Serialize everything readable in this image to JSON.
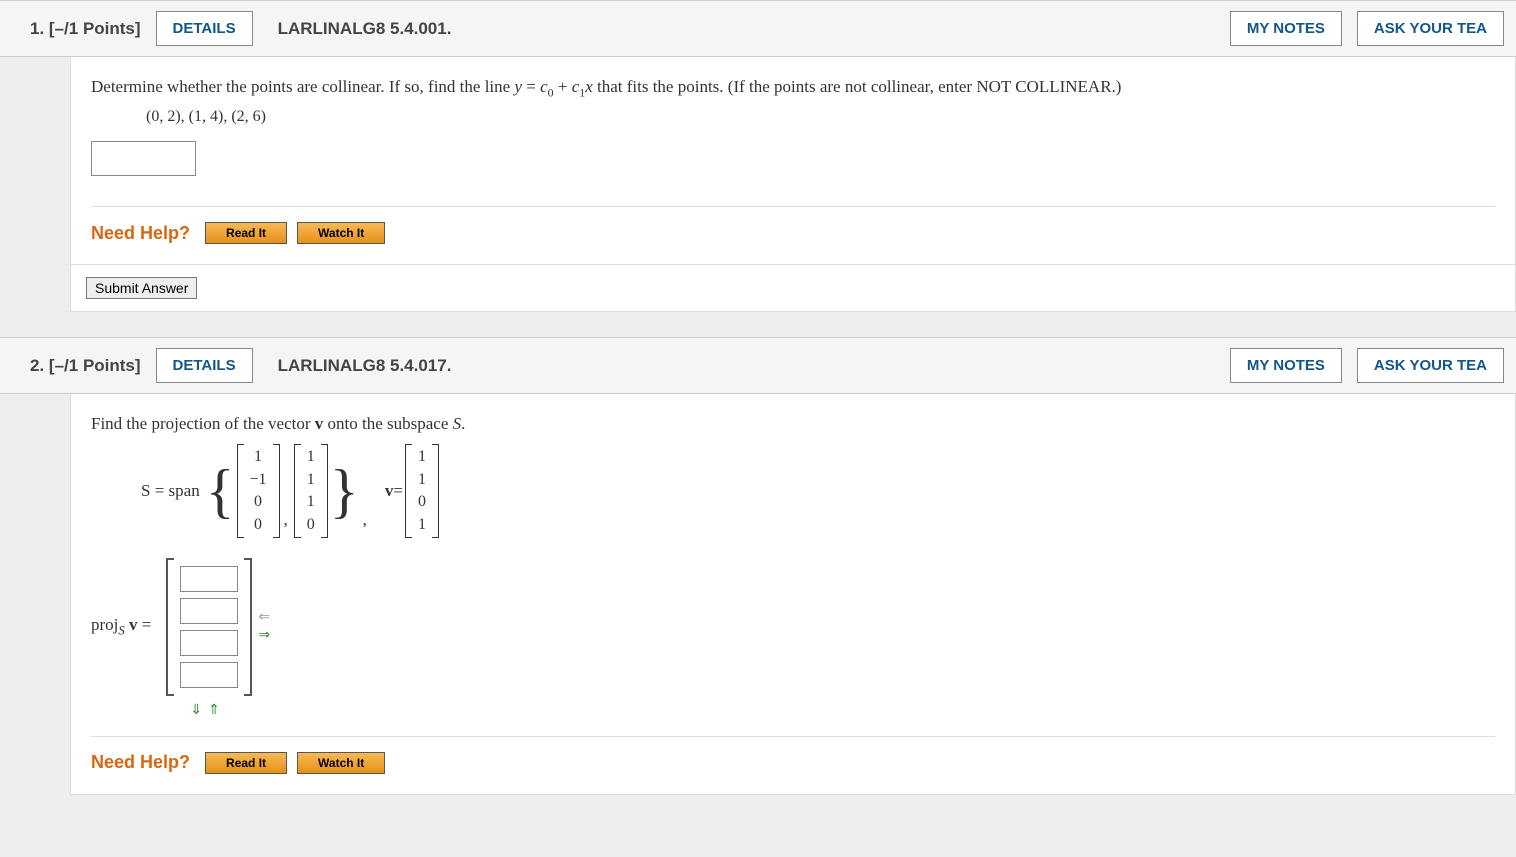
{
  "questions": [
    {
      "number": "1.",
      "points": "[–/1 Points]",
      "details_label": "DETAILS",
      "ref": "LARLINALG8 5.4.001.",
      "notes_label": "MY NOTES",
      "ask_label": "ASK YOUR TEA",
      "prompt_pre": "Determine whether the points are collinear. If so, find the line  ",
      "prompt_eq_y": "y",
      "prompt_eq_eq": " = ",
      "prompt_eq_c0": "c",
      "prompt_eq_c0sub": "0",
      "prompt_eq_plus": " + ",
      "prompt_eq_c1": "c",
      "prompt_eq_c1sub": "1",
      "prompt_eq_x": "x",
      "prompt_post": "  that fits the points. (If the points are not collinear, enter NOT COLLINEAR.)",
      "points_list": "(0, 2), (1, 4), (2, 6)",
      "need_help": "Need Help?",
      "read_it": "Read It",
      "watch_it": "Watch It",
      "submit": "Submit Answer"
    },
    {
      "number": "2.",
      "points": "[–/1 Points]",
      "details_label": "DETAILS",
      "ref": "LARLINALG8 5.4.017.",
      "notes_label": "MY NOTES",
      "ask_label": "ASK YOUR TEA",
      "prompt": "Find the projection of the vector ",
      "prompt_v": "v",
      "prompt2": " onto the subspace ",
      "prompt_S": "S",
      "prompt3": ".",
      "span_label": "S = span",
      "vec1": [
        "1",
        "−1",
        "0",
        "0"
      ],
      "vec2": [
        "1",
        "1",
        "1",
        "0"
      ],
      "v_label": "v",
      "v_eq": " = ",
      "v_vec": [
        "1",
        "1",
        "0",
        "1"
      ],
      "proj_label_pre": "proj",
      "proj_label_sub": "S",
      "proj_label_v": " v",
      "proj_label_eq": " = ",
      "need_help": "Need Help?",
      "read_it": "Read It",
      "watch_it": "Watch It",
      "comma": ","
    }
  ]
}
